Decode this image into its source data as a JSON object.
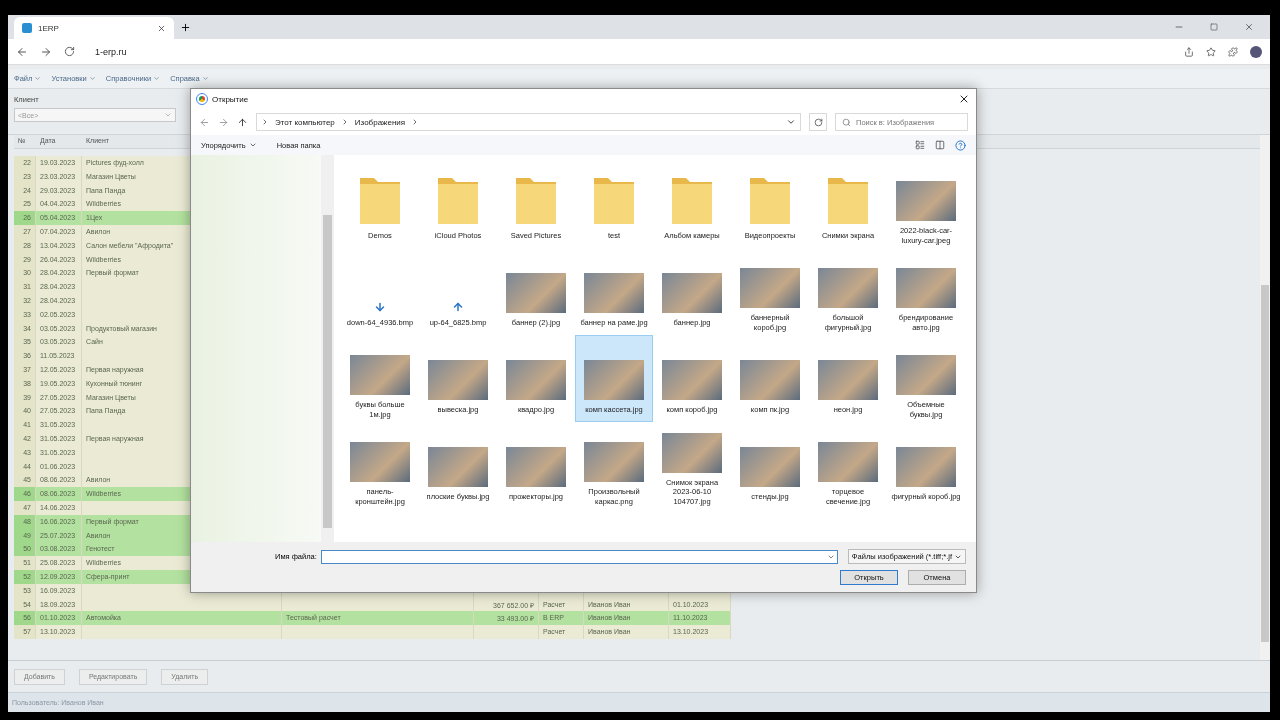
{
  "browser": {
    "tab": {
      "title": "1ERP"
    },
    "url": "1-erp.ru"
  },
  "app": {
    "menu": [
      "Файл",
      "Установки",
      "Справочники",
      "Справка"
    ],
    "filter": {
      "label": "Клиент",
      "value": "<Все>"
    },
    "table": {
      "columns": [
        "№",
        "Дата",
        "Клиент"
      ],
      "rows": [
        {
          "num": "22",
          "date": "19.03.2023",
          "client": "Pictures фуд-холл",
          "highlighted": false
        },
        {
          "num": "23",
          "date": "23.03.2023",
          "client": "Магазин Цветы",
          "highlighted": false
        },
        {
          "num": "24",
          "date": "29.03.2023",
          "client": "Папа Панда",
          "highlighted": false
        },
        {
          "num": "25",
          "date": "04.04.2023",
          "client": "Wildberries",
          "highlighted": false
        },
        {
          "num": "26",
          "date": "05.04.2023",
          "client": "1Цех",
          "highlighted": true
        },
        {
          "num": "27",
          "date": "07.04.2023",
          "client": "Авилон",
          "highlighted": false
        },
        {
          "num": "28",
          "date": "13.04.2023",
          "client": "Салон мебели \"Афродита\"",
          "highlighted": false
        },
        {
          "num": "29",
          "date": "26.04.2023",
          "client": "Wildberries",
          "highlighted": false
        },
        {
          "num": "30",
          "date": "28.04.2023",
          "client": "Первый формат",
          "highlighted": false
        },
        {
          "num": "31",
          "date": "28.04.2023",
          "highlighted": false
        },
        {
          "num": "32",
          "date": "28.04.2023",
          "highlighted": false
        },
        {
          "num": "33",
          "date": "02.05.2023",
          "highlighted": false
        },
        {
          "num": "34",
          "date": "03.05.2023",
          "client": "Продуктовый магазин",
          "highlighted": false
        },
        {
          "num": "35",
          "date": "03.05.2023",
          "client": "Сайн",
          "highlighted": false
        },
        {
          "num": "36",
          "date": "11.05.2023",
          "highlighted": false
        },
        {
          "num": "37",
          "date": "12.05.2023",
          "client": "Первая наружная",
          "highlighted": false
        },
        {
          "num": "38",
          "date": "19.05.2023",
          "client": "Кухонный тюнинг",
          "highlighted": false
        },
        {
          "num": "39",
          "date": "27.05.2023",
          "client": "Магазин Цветы",
          "highlighted": false
        },
        {
          "num": "40",
          "date": "27.05.2023",
          "client": "Папа Панда",
          "highlighted": false
        },
        {
          "num": "41",
          "date": "31.05.2023",
          "highlighted": false
        },
        {
          "num": "42",
          "date": "31.05.2023",
          "client": "Первая наружная",
          "highlighted": false
        },
        {
          "num": "43",
          "date": "31.05.2023",
          "highlighted": false
        },
        {
          "num": "44",
          "date": "01.06.2023",
          "highlighted": false
        },
        {
          "num": "45",
          "date": "08.06.2023",
          "client": "Авилон",
          "highlighted": false
        },
        {
          "num": "46",
          "date": "08.06.2023",
          "client": "Wildberries",
          "highlighted": true
        },
        {
          "num": "47",
          "date": "14.06.2023",
          "highlighted": false
        },
        {
          "num": "48",
          "date": "16.06.2023",
          "client": "Первый формат",
          "highlighted": true
        },
        {
          "num": "49",
          "date": "25.07.2023",
          "client": "Авилон",
          "highlighted": true
        },
        {
          "num": "50",
          "date": "03.08.2023",
          "client": "Генотест",
          "highlighted": true
        },
        {
          "num": "51",
          "date": "25.08.2023",
          "client": "Wildberries",
          "highlighted": false
        },
        {
          "num": "52",
          "date": "12.09.2023",
          "client": "Сфера-принт",
          "highlighted": true
        },
        {
          "num": "53",
          "date": "16.09.2023",
          "highlighted": false
        },
        {
          "num": "54",
          "date": "18.09.2023",
          "amount": "367 652.00 ₽",
          "status": "Расчет",
          "user": "Иванов Иван",
          "due": "01.10.2023",
          "highlighted": false
        },
        {
          "num": "56",
          "date": "01.10.2023",
          "client": "Автомойка",
          "comment": "Тестовый расчет",
          "amount": "33 493.00 ₽",
          "status": "В ERP",
          "user": "Иванов Иван",
          "due": "11.10.2023",
          "highlighted": true
        },
        {
          "num": "57",
          "date": "13.10.2023",
          "status": "Расчет",
          "user": "Иванов Иван",
          "due": "13.10.2023",
          "highlighted": false
        }
      ]
    },
    "buttons": [
      "Добавить",
      "Редактировать",
      "Удалить"
    ],
    "status": "Пользователь: Иванов Иван"
  },
  "dialog": {
    "title": "Открытие",
    "path": [
      "Этот компьютер",
      "Изображения"
    ],
    "search_placeholder": "Поиск в: Изображения",
    "toolbar": [
      "Упорядочить",
      "Новая папка"
    ],
    "files": [
      {
        "name": "Demos",
        "kind": "folder",
        "selected": false
      },
      {
        "name": "iCloud Photos",
        "kind": "folder",
        "selected": false
      },
      {
        "name": "Saved Pictures",
        "kind": "folder",
        "selected": false
      },
      {
        "name": "test",
        "kind": "folder",
        "selected": false
      },
      {
        "name": "Альбом камеры",
        "kind": "folder",
        "selected": false
      },
      {
        "name": "Видеопроекты",
        "kind": "folder",
        "selected": false
      },
      {
        "name": "Снимки экрана",
        "kind": "folder",
        "selected": false
      },
      {
        "name": "2022-black-car-luxury-car.jpeg",
        "kind": "image",
        "selected": false
      },
      {
        "name": "down-64_4936.bmp",
        "kind": "down",
        "selected": false
      },
      {
        "name": "up-64_6825.bmp",
        "kind": "up",
        "selected": false
      },
      {
        "name": "баннер (2).jpg",
        "kind": "image",
        "selected": false
      },
      {
        "name": "баннер на раме.jpg",
        "kind": "image",
        "selected": false
      },
      {
        "name": "баннер.jpg",
        "kind": "image",
        "selected": false
      },
      {
        "name": "баннерный короб.jpg",
        "kind": "image",
        "selected": false
      },
      {
        "name": "большой фигурный.jpg",
        "kind": "image",
        "selected": false
      },
      {
        "name": "брендирование авто.jpg",
        "kind": "image",
        "selected": false
      },
      {
        "name": "буквы больше 1м.jpg",
        "kind": "image",
        "selected": false
      },
      {
        "name": "вывеска.jpg",
        "kind": "image",
        "selected": false
      },
      {
        "name": "квадро.jpg",
        "kind": "image",
        "selected": false
      },
      {
        "name": "комп кассета.jpg",
        "kind": "image",
        "selected": true
      },
      {
        "name": "комп короб.jpg",
        "kind": "image",
        "selected": false
      },
      {
        "name": "комп пк.jpg",
        "kind": "image",
        "selected": false
      },
      {
        "name": "неон.jpg",
        "kind": "image",
        "selected": false
      },
      {
        "name": "Объемные буквы.jpg",
        "kind": "image",
        "selected": false
      },
      {
        "name": "панель-кронштейн.jpg",
        "kind": "image",
        "selected": false
      },
      {
        "name": "плоские буквы.jpg",
        "kind": "image",
        "selected": false
      },
      {
        "name": "прожекторы.jpg",
        "kind": "image",
        "selected": false
      },
      {
        "name": "Произвольный каркас.png",
        "kind": "image",
        "selected": false
      },
      {
        "name": "Снимок экрана 2023-06-10 104707.jpg",
        "kind": "image",
        "selected": false
      },
      {
        "name": "стенды.jpg",
        "kind": "image",
        "selected": false
      },
      {
        "name": "торцевое свечение.jpg",
        "kind": "image",
        "selected": false
      },
      {
        "name": "фигурный короб.jpg",
        "kind": "image",
        "selected": false
      }
    ],
    "filename_label": "Имя файла:",
    "filetype": "Файлы изображений (*.tiff;*.jf",
    "buttons": [
      "Открыть",
      "Отмена"
    ]
  }
}
